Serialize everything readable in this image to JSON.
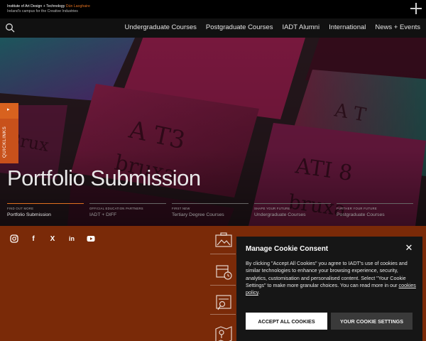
{
  "brand": {
    "line1": "Institute of Art Design + Technology",
    "location": "Dún Laoghaire",
    "line2": "Ireland's campus for the Creative Industries"
  },
  "nav": {
    "items": [
      {
        "label": "Undergraduate Courses"
      },
      {
        "label": "Postgraduate Courses"
      },
      {
        "label": "IADT Alumni"
      },
      {
        "label": "International"
      },
      {
        "label": "News + Events"
      }
    ]
  },
  "quicklinks": {
    "arrow": "▸",
    "label": "QUICKLINKS"
  },
  "hero": {
    "title": "Portfolio Submission",
    "links": [
      {
        "kicker": "FIND OUT MORE",
        "label": "Portfolio Submission"
      },
      {
        "kicker": "OFFICIAL EDUCATION PARTNERS",
        "label": "IADT + DIFF"
      },
      {
        "kicker": "FIRST NEW",
        "label": "Tertiary Degree Courses"
      },
      {
        "kicker": "SHAPE YOUR FUTURE",
        "label": "Undergraduate Courses"
      },
      {
        "kicker": "FURTHER YOUR FUTURE",
        "label": "Postgraduate Courses"
      }
    ]
  },
  "social": {
    "icons": [
      "instagram-icon",
      "facebook-icon",
      "x-icon",
      "linkedin-icon",
      "youtube-icon"
    ],
    "facebook_glyph": "f",
    "x_glyph": "X",
    "linkedin_glyph": "in"
  },
  "cookie": {
    "title": "Manage Cookie Consent",
    "close": "✕",
    "body_text": "By clicking \"Accept All Cookies\" you agree to IADT's use of cookies and similar technologies to enhance your browsing experience, security, analytics, customisation and personalised content. Select \"Your Cookie Settings\" to make more granular choices. You can read more in our ",
    "policy_link": "cookies policy",
    "body_end": ".",
    "accept_label": "ACCEPT ALL COOKIES",
    "settings_label": "YOUR COOKIE SETTINGS"
  },
  "colors": {
    "accent": "#e0701f",
    "band": "#7a2a08",
    "dialog": "#161616"
  }
}
